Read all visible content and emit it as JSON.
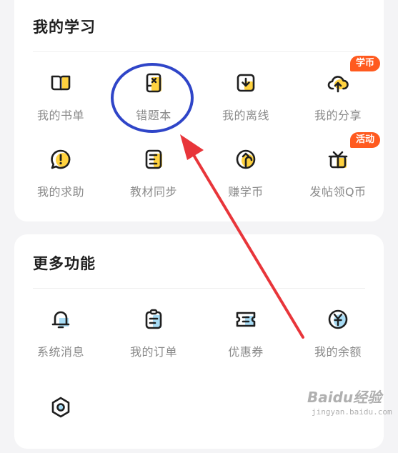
{
  "sections": {
    "study": {
      "title": "我的学习",
      "items": [
        {
          "label": "我的书单",
          "icon": "book-open-icon"
        },
        {
          "label": "错题本",
          "icon": "error-notebook-icon"
        },
        {
          "label": "我的离线",
          "icon": "download-icon"
        },
        {
          "label": "我的分享",
          "icon": "upload-cloud-icon",
          "badge": "学币"
        },
        {
          "label": "我的求助",
          "icon": "help-bubble-icon"
        },
        {
          "label": "教材同步",
          "icon": "textbook-icon"
        },
        {
          "label": "赚学币",
          "icon": "arrow-up-circle-icon"
        },
        {
          "label": "发帖领Q币",
          "icon": "gift-box-icon",
          "badge": "活动"
        }
      ]
    },
    "more": {
      "title": "更多功能",
      "items": [
        {
          "label": "系统消息",
          "icon": "bell-icon"
        },
        {
          "label": "我的订单",
          "icon": "clipboard-icon"
        },
        {
          "label": "优惠券",
          "icon": "coupon-icon"
        },
        {
          "label": "我的余额",
          "icon": "yuan-coin-icon"
        },
        {
          "label": "",
          "icon": "settings-icon"
        }
      ]
    }
  },
  "colors": {
    "accent_yellow": "#ffd23f",
    "icon_stroke": "#1f1f1f",
    "badge": "#ff5a1f",
    "annotation_circle": "#2f45c8",
    "annotation_arrow": "#e8353a",
    "label": "#8a8a8a"
  },
  "watermark": {
    "brand": "Baidu经验",
    "url": "jingyan.baidu.com"
  }
}
